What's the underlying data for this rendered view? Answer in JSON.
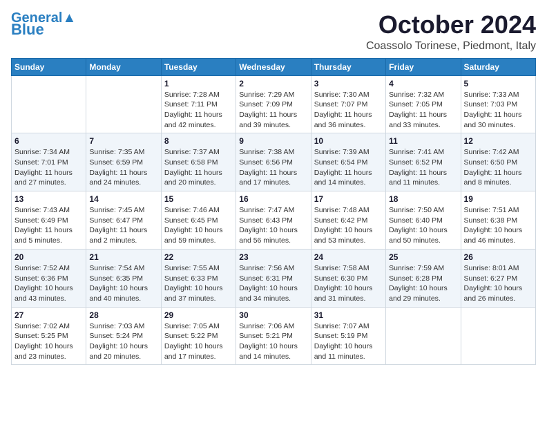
{
  "logo": {
    "line1": "General",
    "line2": "Blue"
  },
  "title": "October 2024",
  "location": "Coassolo Torinese, Piedmont, Italy",
  "days_of_week": [
    "Sunday",
    "Monday",
    "Tuesday",
    "Wednesday",
    "Thursday",
    "Friday",
    "Saturday"
  ],
  "weeks": [
    [
      {
        "day": null
      },
      {
        "day": null
      },
      {
        "day": 1,
        "sunrise": "Sunrise: 7:28 AM",
        "sunset": "Sunset: 7:11 PM",
        "daylight": "Daylight: 11 hours and 42 minutes."
      },
      {
        "day": 2,
        "sunrise": "Sunrise: 7:29 AM",
        "sunset": "Sunset: 7:09 PM",
        "daylight": "Daylight: 11 hours and 39 minutes."
      },
      {
        "day": 3,
        "sunrise": "Sunrise: 7:30 AM",
        "sunset": "Sunset: 7:07 PM",
        "daylight": "Daylight: 11 hours and 36 minutes."
      },
      {
        "day": 4,
        "sunrise": "Sunrise: 7:32 AM",
        "sunset": "Sunset: 7:05 PM",
        "daylight": "Daylight: 11 hours and 33 minutes."
      },
      {
        "day": 5,
        "sunrise": "Sunrise: 7:33 AM",
        "sunset": "Sunset: 7:03 PM",
        "daylight": "Daylight: 11 hours and 30 minutes."
      }
    ],
    [
      {
        "day": 6,
        "sunrise": "Sunrise: 7:34 AM",
        "sunset": "Sunset: 7:01 PM",
        "daylight": "Daylight: 11 hours and 27 minutes."
      },
      {
        "day": 7,
        "sunrise": "Sunrise: 7:35 AM",
        "sunset": "Sunset: 6:59 PM",
        "daylight": "Daylight: 11 hours and 24 minutes."
      },
      {
        "day": 8,
        "sunrise": "Sunrise: 7:37 AM",
        "sunset": "Sunset: 6:58 PM",
        "daylight": "Daylight: 11 hours and 20 minutes."
      },
      {
        "day": 9,
        "sunrise": "Sunrise: 7:38 AM",
        "sunset": "Sunset: 6:56 PM",
        "daylight": "Daylight: 11 hours and 17 minutes."
      },
      {
        "day": 10,
        "sunrise": "Sunrise: 7:39 AM",
        "sunset": "Sunset: 6:54 PM",
        "daylight": "Daylight: 11 hours and 14 minutes."
      },
      {
        "day": 11,
        "sunrise": "Sunrise: 7:41 AM",
        "sunset": "Sunset: 6:52 PM",
        "daylight": "Daylight: 11 hours and 11 minutes."
      },
      {
        "day": 12,
        "sunrise": "Sunrise: 7:42 AM",
        "sunset": "Sunset: 6:50 PM",
        "daylight": "Daylight: 11 hours and 8 minutes."
      }
    ],
    [
      {
        "day": 13,
        "sunrise": "Sunrise: 7:43 AM",
        "sunset": "Sunset: 6:49 PM",
        "daylight": "Daylight: 11 hours and 5 minutes."
      },
      {
        "day": 14,
        "sunrise": "Sunrise: 7:45 AM",
        "sunset": "Sunset: 6:47 PM",
        "daylight": "Daylight: 11 hours and 2 minutes."
      },
      {
        "day": 15,
        "sunrise": "Sunrise: 7:46 AM",
        "sunset": "Sunset: 6:45 PM",
        "daylight": "Daylight: 10 hours and 59 minutes."
      },
      {
        "day": 16,
        "sunrise": "Sunrise: 7:47 AM",
        "sunset": "Sunset: 6:43 PM",
        "daylight": "Daylight: 10 hours and 56 minutes."
      },
      {
        "day": 17,
        "sunrise": "Sunrise: 7:48 AM",
        "sunset": "Sunset: 6:42 PM",
        "daylight": "Daylight: 10 hours and 53 minutes."
      },
      {
        "day": 18,
        "sunrise": "Sunrise: 7:50 AM",
        "sunset": "Sunset: 6:40 PM",
        "daylight": "Daylight: 10 hours and 50 minutes."
      },
      {
        "day": 19,
        "sunrise": "Sunrise: 7:51 AM",
        "sunset": "Sunset: 6:38 PM",
        "daylight": "Daylight: 10 hours and 46 minutes."
      }
    ],
    [
      {
        "day": 20,
        "sunrise": "Sunrise: 7:52 AM",
        "sunset": "Sunset: 6:36 PM",
        "daylight": "Daylight: 10 hours and 43 minutes."
      },
      {
        "day": 21,
        "sunrise": "Sunrise: 7:54 AM",
        "sunset": "Sunset: 6:35 PM",
        "daylight": "Daylight: 10 hours and 40 minutes."
      },
      {
        "day": 22,
        "sunrise": "Sunrise: 7:55 AM",
        "sunset": "Sunset: 6:33 PM",
        "daylight": "Daylight: 10 hours and 37 minutes."
      },
      {
        "day": 23,
        "sunrise": "Sunrise: 7:56 AM",
        "sunset": "Sunset: 6:31 PM",
        "daylight": "Daylight: 10 hours and 34 minutes."
      },
      {
        "day": 24,
        "sunrise": "Sunrise: 7:58 AM",
        "sunset": "Sunset: 6:30 PM",
        "daylight": "Daylight: 10 hours and 31 minutes."
      },
      {
        "day": 25,
        "sunrise": "Sunrise: 7:59 AM",
        "sunset": "Sunset: 6:28 PM",
        "daylight": "Daylight: 10 hours and 29 minutes."
      },
      {
        "day": 26,
        "sunrise": "Sunrise: 8:01 AM",
        "sunset": "Sunset: 6:27 PM",
        "daylight": "Daylight: 10 hours and 26 minutes."
      }
    ],
    [
      {
        "day": 27,
        "sunrise": "Sunrise: 7:02 AM",
        "sunset": "Sunset: 5:25 PM",
        "daylight": "Daylight: 10 hours and 23 minutes."
      },
      {
        "day": 28,
        "sunrise": "Sunrise: 7:03 AM",
        "sunset": "Sunset: 5:24 PM",
        "daylight": "Daylight: 10 hours and 20 minutes."
      },
      {
        "day": 29,
        "sunrise": "Sunrise: 7:05 AM",
        "sunset": "Sunset: 5:22 PM",
        "daylight": "Daylight: 10 hours and 17 minutes."
      },
      {
        "day": 30,
        "sunrise": "Sunrise: 7:06 AM",
        "sunset": "Sunset: 5:21 PM",
        "daylight": "Daylight: 10 hours and 14 minutes."
      },
      {
        "day": 31,
        "sunrise": "Sunrise: 7:07 AM",
        "sunset": "Sunset: 5:19 PM",
        "daylight": "Daylight: 10 hours and 11 minutes."
      },
      {
        "day": null
      },
      {
        "day": null
      }
    ]
  ]
}
